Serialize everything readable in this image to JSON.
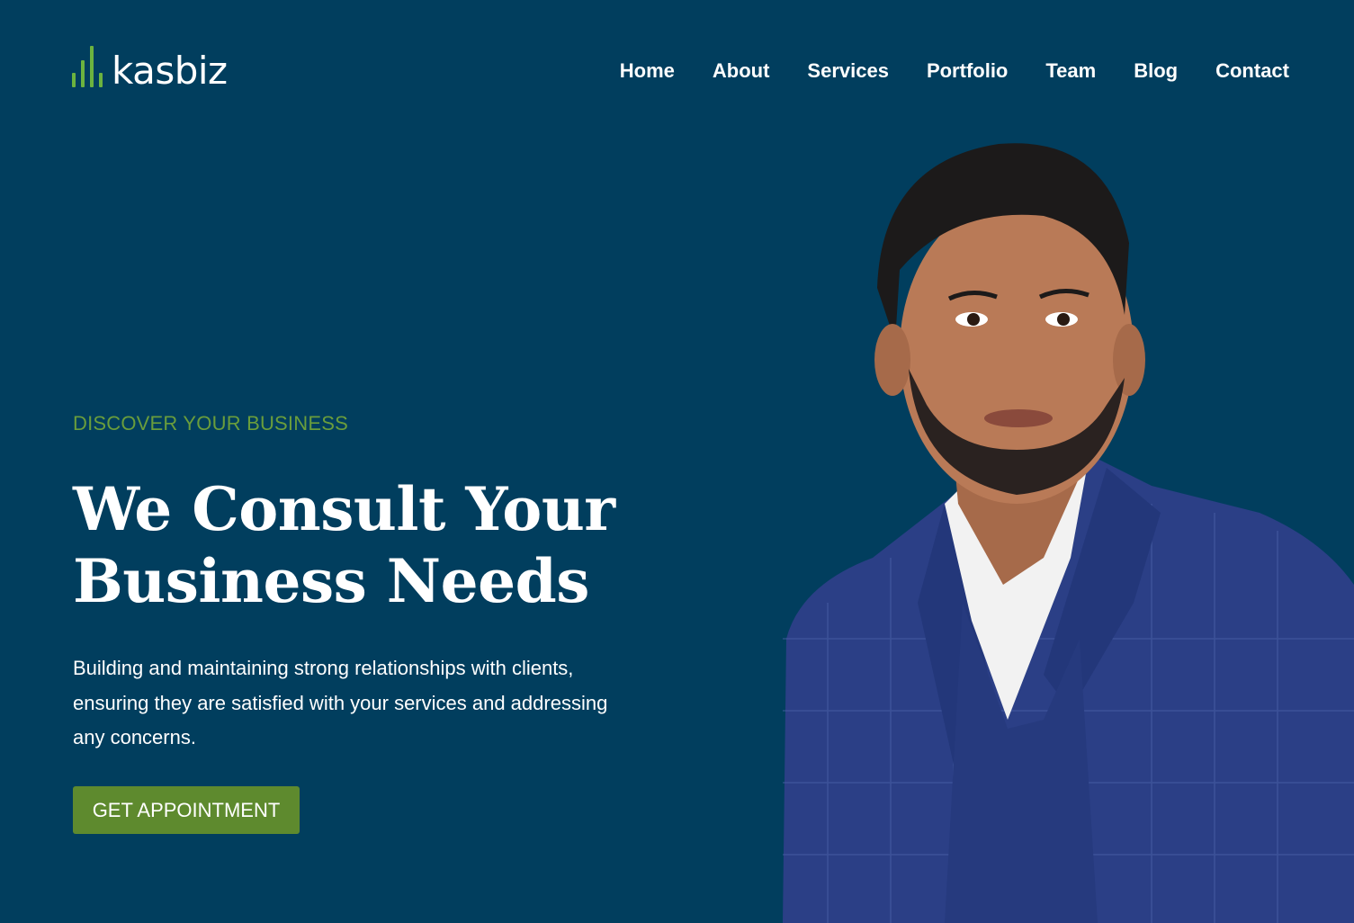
{
  "brand": {
    "name": "kasbiz",
    "icon": "bar-chart-logo-icon",
    "accent_color": "#6cb33f"
  },
  "nav": {
    "items": [
      {
        "label": "Home"
      },
      {
        "label": "About"
      },
      {
        "label": "Services"
      },
      {
        "label": "Portfolio"
      },
      {
        "label": "Team"
      },
      {
        "label": "Blog"
      },
      {
        "label": "Contact"
      }
    ]
  },
  "hero": {
    "eyebrow": "DISCOVER YOUR BUSINESS",
    "headline_line1": "We Consult Your",
    "headline_line2": "Business Needs",
    "description": "Building and maintaining strong relationships with clients, ensuring they are satisfied with your services and addressing any concerns.",
    "cta_label": "GET APPOINTMENT"
  },
  "colors": {
    "background": "#013e5e",
    "eyebrow": "#6a9d3c",
    "button": "#5e8a2e",
    "text": "#ffffff"
  }
}
